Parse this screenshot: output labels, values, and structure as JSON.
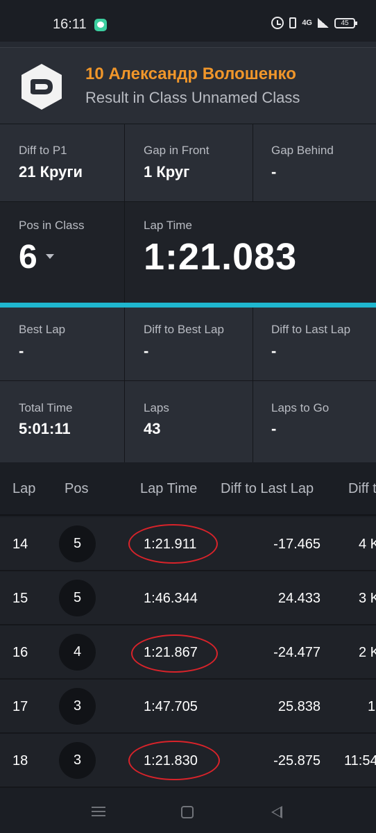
{
  "status_bar": {
    "time": "16:11",
    "network": "4G",
    "battery": "45",
    "icons": [
      "chat-app-icon",
      "alarm-icon",
      "vibrate-icon",
      "signal-icon",
      "battery-icon"
    ]
  },
  "header": {
    "driver_name": "10 Александр Волошенко",
    "subtitle": "Result in Class Unnamed Class",
    "accent_color": "#f0962a",
    "logo_icon": "app-logo-icon"
  },
  "stats": {
    "diff_to_p1": {
      "label": "Diff to P1",
      "value": "21 Круги"
    },
    "gap_in_front": {
      "label": "Gap in Front",
      "value": "1 Круг"
    },
    "gap_behind": {
      "label": "Gap Behind",
      "value": "-"
    },
    "pos_in_class": {
      "label": "Pos in Class",
      "value": "6"
    },
    "lap_time": {
      "label": "Lap Time",
      "value": "1:21.083"
    },
    "best_lap": {
      "label": "Best Lap",
      "value": "-"
    },
    "diff_to_best_lap": {
      "label": "Diff to Best Lap",
      "value": "-"
    },
    "diff_to_last_lap": {
      "label": "Diff to Last Lap",
      "value": "-"
    },
    "total_time": {
      "label": "Total Time",
      "value": "5:01:11"
    },
    "laps": {
      "label": "Laps",
      "value": "43"
    },
    "laps_to_go": {
      "label": "Laps to Go",
      "value": "-"
    },
    "divider_color": "#1fb7cf"
  },
  "table": {
    "headers": [
      "Lap",
      "Pos",
      "Lap Time",
      "Diff to Last Lap",
      "Diff t"
    ],
    "rows": [
      {
        "lap": "14",
        "pos": "5",
        "lap_time": "1:21.911",
        "diff_last": "-17.465",
        "diff_extra": "4 K",
        "circled": true
      },
      {
        "lap": "15",
        "pos": "5",
        "lap_time": "1:46.344",
        "diff_last": "24.433",
        "diff_extra": "3 K",
        "circled": false
      },
      {
        "lap": "16",
        "pos": "4",
        "lap_time": "1:21.867",
        "diff_last": "-24.477",
        "diff_extra": "2 K",
        "circled": true
      },
      {
        "lap": "17",
        "pos": "3",
        "lap_time": "1:47.705",
        "diff_last": "25.838",
        "diff_extra": "1",
        "circled": false
      },
      {
        "lap": "18",
        "pos": "3",
        "lap_time": "1:21.830",
        "diff_last": "-25.875",
        "diff_extra": "11:54",
        "circled": true
      }
    ],
    "annotation_color": "#d8232a"
  },
  "nav_bar": {
    "icons": [
      "menu-icon",
      "home-icon",
      "back-icon"
    ]
  }
}
